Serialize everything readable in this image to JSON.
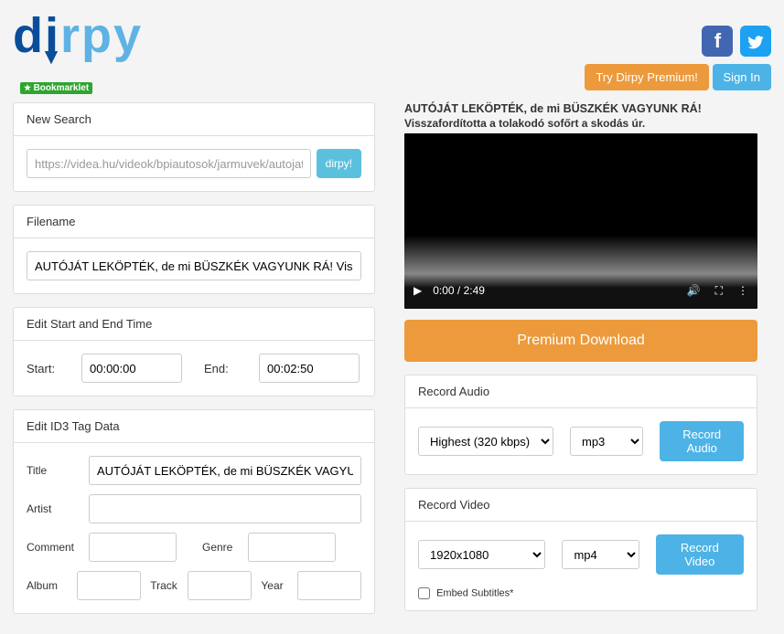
{
  "header": {
    "bookmarklet": "Bookmarklet",
    "tryPremium": "Try Dirpy Premium!",
    "signIn": "Sign In"
  },
  "search": {
    "heading": "New Search",
    "url": "https://videa.hu/videok/bpiautosok/jarmuvek/autojat-lekoptek-de-mi-",
    "go": "dirpy!"
  },
  "filename": {
    "heading": "Filename",
    "value": "AUTÓJÁT LEKÖPTÉK, de mi BÜSZKÉK VAGYUNK RÁ! Visszafordította a to"
  },
  "time": {
    "heading": "Edit Start and End Time",
    "startLabel": "Start:",
    "start": "00:00:00",
    "endLabel": "End:",
    "end": "00:02:50"
  },
  "id3": {
    "heading": "Edit ID3 Tag Data",
    "titleLabel": "Title",
    "title": "AUTÓJÁT LEKÖPTÉK, de mi BÜSZKÉK VAGYUNK RÁ! Vissz",
    "artistLabel": "Artist",
    "artist": "",
    "commentLabel": "Comment",
    "comment": "",
    "genreLabel": "Genre",
    "genre": "",
    "albumLabel": "Album",
    "album": "",
    "trackLabel": "Track",
    "track": "",
    "yearLabel": "Year",
    "year": ""
  },
  "video": {
    "title": "AUTÓJÁT LEKÖPTÉK, de mi BÜSZKÉK VAGYUNK RÁ!",
    "subtitle": "Visszafordította a tolakodó sofőrt a skodás úr.",
    "time": "0:00 / 2:49"
  },
  "premium": {
    "download": "Premium Download"
  },
  "audio": {
    "heading": "Record Audio",
    "quality": "Highest (320 kbps)",
    "format": "mp3",
    "button": "Record Audio"
  },
  "videoRec": {
    "heading": "Record Video",
    "res": "1920x1080",
    "format": "mp4",
    "button": "Record Video",
    "embed": "Embed Subtitles*"
  }
}
